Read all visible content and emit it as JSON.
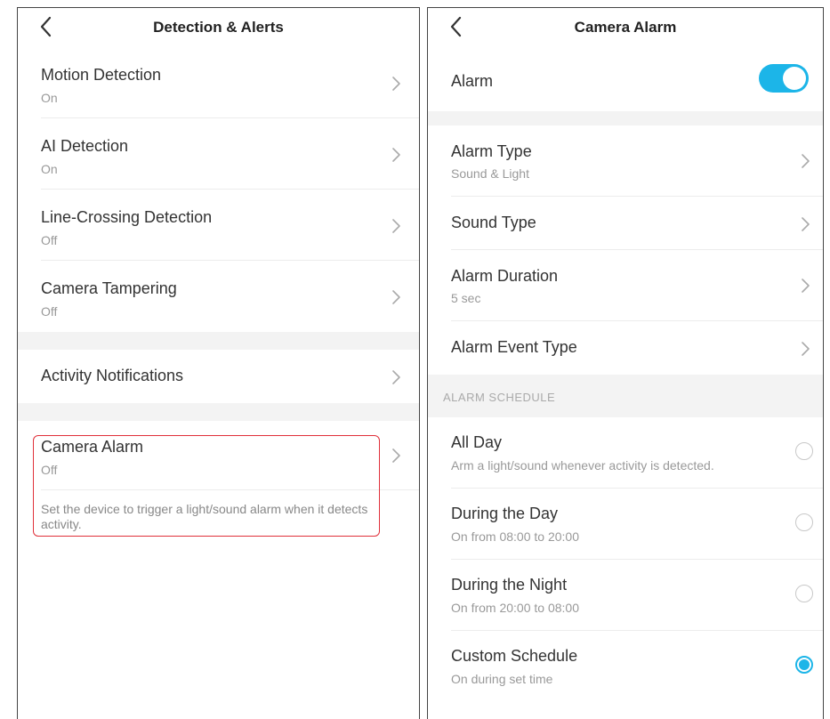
{
  "left_screen": {
    "title": "Detection & Alerts",
    "items": [
      {
        "label": "Motion Detection",
        "status": "On"
      },
      {
        "label": "AI Detection",
        "status": "On"
      },
      {
        "label": "Line-Crossing Detection",
        "status": "Off"
      },
      {
        "label": "Camera Tampering",
        "status": "Off"
      }
    ],
    "activity_notifications": {
      "label": "Activity Notifications"
    },
    "camera_alarm": {
      "label": "Camera Alarm",
      "status": "Off",
      "description": "Set the device to trigger a light/sound alarm when it detects activity."
    }
  },
  "right_screen": {
    "title": "Camera Alarm",
    "alarm": {
      "label": "Alarm",
      "enabled": true
    },
    "settings": [
      {
        "label": "Alarm Type",
        "value": "Sound & Light"
      },
      {
        "label": "Sound Type",
        "value": ""
      },
      {
        "label": "Alarm Duration",
        "value": "5 sec"
      },
      {
        "label": "Alarm Event Type",
        "value": ""
      }
    ],
    "schedule": {
      "header": "ALARM SCHEDULE",
      "options": [
        {
          "label": "All Day",
          "description": "Arm a light/sound whenever activity is detected.",
          "selected": false
        },
        {
          "label": "During the Day",
          "description": "On from 08:00 to 20:00",
          "selected": false
        },
        {
          "label": "During the Night",
          "description": "On from 20:00 to 08:00",
          "selected": false
        },
        {
          "label": "Custom Schedule",
          "description": "On during set time",
          "selected": true
        }
      ]
    }
  },
  "colors": {
    "accent": "#1cb5e8",
    "highlight_border": "#e0303a",
    "section_gap": "#f3f3f3"
  },
  "icons": {
    "back": "chevron-left-icon",
    "row_arrow": "chevron-right-icon"
  }
}
